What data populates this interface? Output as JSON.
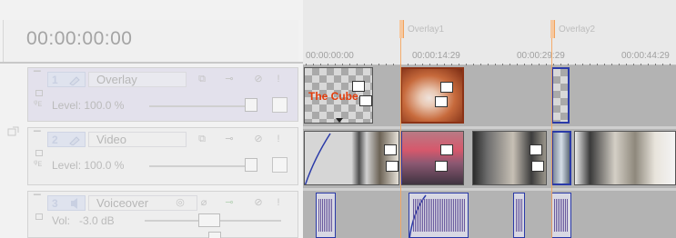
{
  "timecode": "00:00:00:00",
  "markers": [
    {
      "label": "Overlay1"
    },
    {
      "label": "Overlay2"
    }
  ],
  "ruler_ticks": [
    "00:00:00:00",
    "00:00:14:29",
    "00:00:29:29",
    "00:00:44:29"
  ],
  "tracks": [
    {
      "number": "1",
      "name": "Overlay",
      "type": "video",
      "level_label": "Level: 100.0 %"
    },
    {
      "number": "2",
      "name": "Video",
      "type": "video",
      "level_label": "Level: 100.0 %"
    },
    {
      "number": "3",
      "name": "Voiceover",
      "type": "audio",
      "level_label": "Vol:",
      "volume": "-3.0 dB"
    }
  ],
  "clips": {
    "overlay_title": "The Cube"
  },
  "colors": {
    "marker": "#f5a55e",
    "fade_line": "#2a3aa8",
    "waveform": "#6a5a9e",
    "title_text": "#e43b0a"
  }
}
